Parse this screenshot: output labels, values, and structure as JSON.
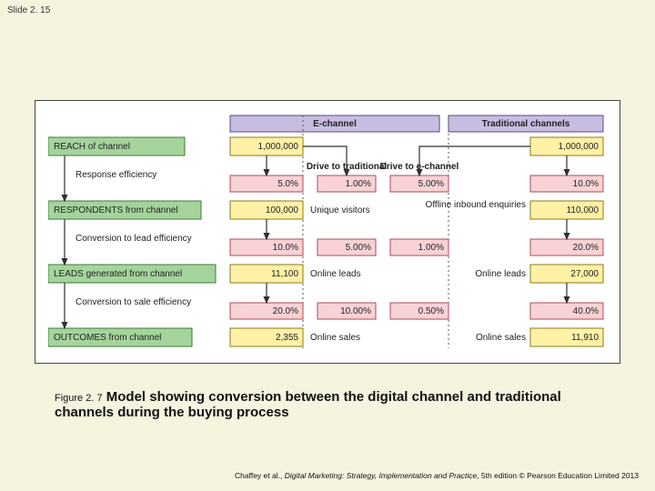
{
  "slide_number": "Slide 2. 15",
  "figure_number": "Figure 2. 7",
  "caption": "Model showing conversion between the digital channel and traditional channels during the buying process",
  "footer_authors": "Chaffey et al., ",
  "footer_title": "Digital Marketing: Strategy, Implementation and Practice",
  "footer_edition": ", 5th edition © Pearson Education Limited 2013",
  "headers": {
    "echannel": "E-channel",
    "traditional": "Traditional channels"
  },
  "stage_labels": {
    "reach": "REACH of channel",
    "respondents": "RESPONDENTS from channel",
    "leads": "LEADS generated from channel",
    "outcomes": "OUTCOMES from channel"
  },
  "metric_labels": {
    "response": "Response efficiency",
    "conv_lead": "Conversion to lead efficiency",
    "conv_sale": "Conversion to sale efficiency",
    "drive_trad": "Drive to traditional",
    "drive_ech": "Drive to e-channel"
  },
  "row_labels": {
    "unique_visitors": "Unique visitors",
    "online_leads": "Online leads",
    "online_sales": "Online sales",
    "offline_inbound": "Offline inbound enquiries"
  },
  "data": {
    "echannel": {
      "reach": "1,000,000",
      "response_eff": "5.0%",
      "respondents": "100,000",
      "lead_eff": "10.0%",
      "leads": "11,100",
      "sale_eff": "20.0%",
      "outcomes": "2,355"
    },
    "drive_trad": {
      "response_eff": "1.00%",
      "lead_eff": "5.00%",
      "sale_eff": "10.00%"
    },
    "drive_ech": {
      "response_eff": "5.00%",
      "lead_eff": "1.00%",
      "sale_eff": "0.50%"
    },
    "traditional": {
      "reach": "1,000,000",
      "response_eff": "10.0%",
      "respondents": "110,000",
      "lead_eff": "20.0%",
      "leads": "27,000",
      "sale_eff": "40.0%",
      "outcomes": "11,910"
    }
  }
}
